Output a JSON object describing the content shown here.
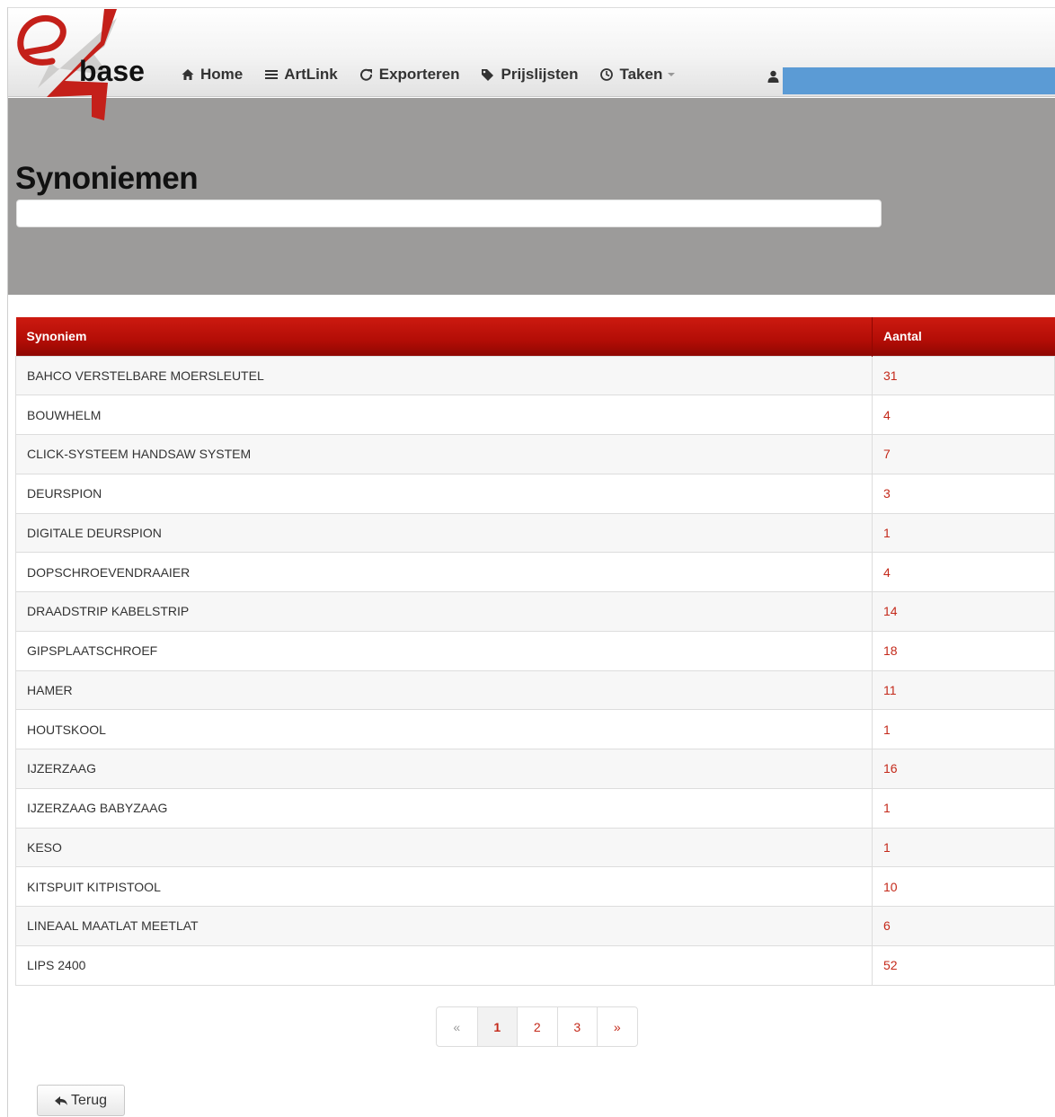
{
  "logo": {
    "letter": "e",
    "wordmark": "base",
    "accent_color": "#c4201a"
  },
  "nav": {
    "items": [
      {
        "label": "Home",
        "icon": "home-icon"
      },
      {
        "label": "ArtLink",
        "icon": "list-icon"
      },
      {
        "label": "Exporteren",
        "icon": "export-icon"
      },
      {
        "label": "Prijslijsten",
        "icon": "tags-icon"
      },
      {
        "label": "Taken",
        "icon": "clock-icon",
        "dropdown": true
      }
    ],
    "user_icon": "user-icon",
    "user_bar_color": "#5b9bd5"
  },
  "hero": {
    "title": "Synoniemen",
    "filter_value": ""
  },
  "table": {
    "headers": {
      "synonym": "Synoniem",
      "count": "Aantal"
    },
    "header_color": "#b30d06",
    "rows": [
      {
        "name": "BAHCO VERSTELBARE MOERSLEUTEL",
        "count": "31"
      },
      {
        "name": "BOUWHELM",
        "count": "4"
      },
      {
        "name": "CLICK-SYSTEEM HANDSAW SYSTEM",
        "count": "7"
      },
      {
        "name": "DEURSPION",
        "count": "3"
      },
      {
        "name": "DIGITALE DEURSPION",
        "count": "1"
      },
      {
        "name": "DOPSCHROEVENDRAAIER",
        "count": "4"
      },
      {
        "name": "DRAADSTRIP KABELSTRIP",
        "count": "14"
      },
      {
        "name": "GIPSPLAATSCHROEF",
        "count": "18"
      },
      {
        "name": "HAMER",
        "count": "11"
      },
      {
        "name": "HOUTSKOOL",
        "count": "1"
      },
      {
        "name": "IJZERZAAG",
        "count": "16"
      },
      {
        "name": "IJZERZAAG BABYZAAG",
        "count": "1"
      },
      {
        "name": "KESO",
        "count": "1"
      },
      {
        "name": "KITSPUIT KITPISTOOL",
        "count": "10"
      },
      {
        "name": "LINEAAL MAATLAT MEETLAT",
        "count": "6"
      },
      {
        "name": "LIPS 2400",
        "count": "52"
      }
    ]
  },
  "pagination": {
    "prev": "«",
    "pages": [
      "1",
      "2",
      "3"
    ],
    "current": "1",
    "next": "»"
  },
  "back_button": {
    "label": "Terug",
    "icon": "back-arrow-icon"
  }
}
